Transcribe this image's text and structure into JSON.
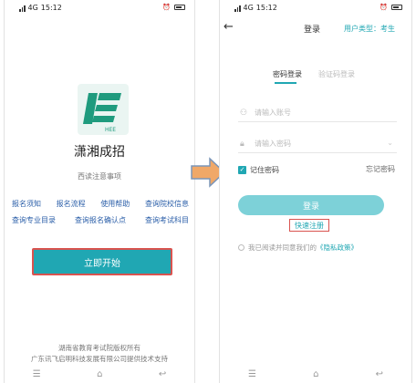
{
  "status_bar": {
    "time": "15:12",
    "signal": "4G"
  },
  "left_screen": {
    "app_name": "潇湘成招",
    "logo_text": "HEE",
    "notice_title": "西读注意事项",
    "links_row_1": [
      "报名须知",
      "报名流程",
      "使用帮助",
      "查询院校信息"
    ],
    "links_row_2": [
      "查询专业目录",
      "查询报名确认点",
      "查询考试科目"
    ],
    "start_button": "立即开始",
    "footer_1": "湖南省教育考试院版权所有",
    "footer_2": "广东讯飞启明科技发展有限公司提供技术支持"
  },
  "right_screen": {
    "title": "登录",
    "user_type_label": "用户类型：",
    "user_type_value": "考生",
    "tabs": [
      "密码登录",
      "验证码登录"
    ],
    "account_placeholder": "请输入账号",
    "password_placeholder": "请输入密码",
    "remember_label": "记住密码",
    "forgot_label": "忘记密码",
    "login_button": "登录",
    "quick_register": "快速注册",
    "agree_prefix": "我已阅读并同意我们的",
    "policy_link": "《隐私政策》"
  },
  "colors": {
    "accent": "#20a7b3",
    "highlight": "#d9534f",
    "arrow": "#f0a868"
  },
  "icons": [
    "back-arrow-icon",
    "user-icon",
    "lock-icon",
    "chevron-down-icon",
    "check-icon",
    "menu-icon",
    "home-icon",
    "return-icon",
    "right-arrow-icon"
  ]
}
